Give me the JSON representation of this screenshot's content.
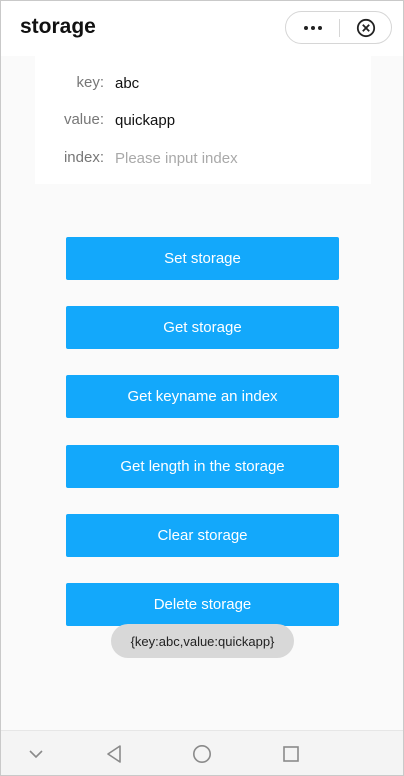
{
  "header": {
    "title": "storage",
    "more_icon": "more-dots-icon",
    "close_icon": "close-circle-icon"
  },
  "form": {
    "key": {
      "label": "key:",
      "value": "abc",
      "placeholder": ""
    },
    "value": {
      "label": "value:",
      "value": "quickapp",
      "placeholder": ""
    },
    "index": {
      "label": "index:",
      "value": "",
      "placeholder": "Please input index"
    }
  },
  "buttons": {
    "set": "Set storage",
    "get": "Get storage",
    "keyname": "Get keyname an index",
    "length": "Get length in the storage",
    "clear": "Clear storage",
    "delete": "Delete storage"
  },
  "toast": {
    "text": "{key:abc,value:quickapp}"
  },
  "navbar": {
    "icons": [
      "chevron-down-icon",
      "back-triangle-icon",
      "home-circle-icon",
      "recents-square-icon"
    ]
  },
  "colors": {
    "accent": "#13a8fb",
    "toast_bg": "#d8d8d8"
  }
}
